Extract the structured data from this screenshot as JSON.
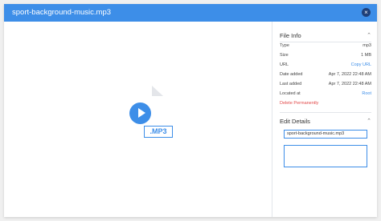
{
  "modal": {
    "title": "sport-background-music.mp3",
    "close_glyph": "×"
  },
  "preview": {
    "extension": ".MP3"
  },
  "file_info": {
    "heading": "File Info",
    "rows": [
      {
        "label": "Type",
        "value": "mp3"
      },
      {
        "label": "Size",
        "value": "1 MB"
      },
      {
        "label": "URL",
        "value": "Copy URL"
      },
      {
        "label": "Date added",
        "value": "Apr 7, 2022 22:48 AM"
      },
      {
        "label": "Last added",
        "value": "Apr 7, 2022 22:48 AM"
      },
      {
        "label": "Located at",
        "value": "Root"
      }
    ],
    "delete_label": "Delete Permanently"
  },
  "edit_details": {
    "heading": "Edit Details",
    "name_value": "sport-background-music.mp3",
    "description_value": ""
  },
  "icons": {
    "collapse": "chevron-up-icon",
    "close": "close-icon",
    "play": "play-icon"
  },
  "colors": {
    "accent": "#3d8ee8",
    "danger": "#e24b4b",
    "close_bg": "#1f3f78"
  }
}
